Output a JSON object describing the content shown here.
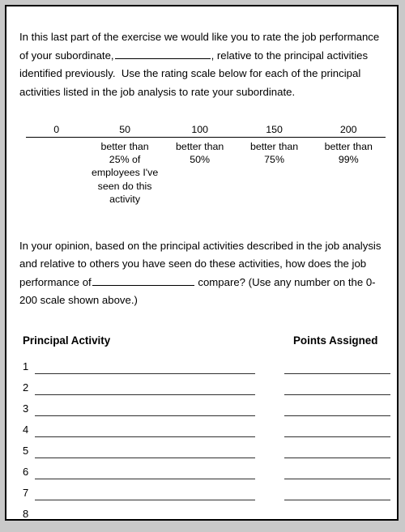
{
  "document": {
    "intro_paragraph": {
      "segment_1": "In this last part of the exercise we would like you to rate the job performance of your subordinate,",
      "segment_2": ", relative to the principal activities identified previously.  Use the rating scale below for each of the principal activities listed in the job analysis to rate your subordinate."
    },
    "rating_scale": {
      "ticks": [
        "0",
        "50",
        "100",
        "150",
        "200"
      ],
      "descriptions": [
        "",
        "better than\n25% of\nemployees I've\nseen do this\nactivity",
        "better than\n50%",
        "better than\n75%",
        "better than\n99%"
      ]
    },
    "opinion_paragraph": {
      "segment_1": "In your opinion, based on the principal activities described in the job analysis and relative to others you have seen do these activities, how does the job performance of",
      "segment_2": " compare? (Use any number on the 0-200 scale shown above.)"
    },
    "table": {
      "header_left": "Principal Activity",
      "header_right": "Points Assigned",
      "rows": [
        {
          "number": "1",
          "activity": "",
          "points": ""
        },
        {
          "number": "2",
          "activity": "",
          "points": ""
        },
        {
          "number": "3",
          "activity": "",
          "points": ""
        },
        {
          "number": "4",
          "activity": "",
          "points": ""
        },
        {
          "number": "5",
          "activity": "",
          "points": ""
        },
        {
          "number": "6",
          "activity": "",
          "points": ""
        },
        {
          "number": "7",
          "activity": "",
          "points": ""
        },
        {
          "number": "8",
          "activity": "",
          "points": ""
        }
      ]
    }
  }
}
